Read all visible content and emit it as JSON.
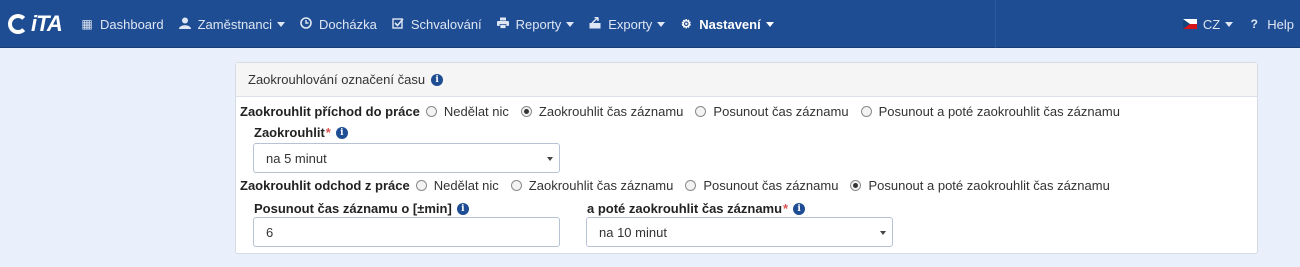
{
  "brand": {
    "logo_text": "iTA"
  },
  "nav": {
    "items": [
      {
        "label": "Dashboard",
        "icon": "grid-icon",
        "caret": false,
        "active": false
      },
      {
        "label": "Zaměstnanci",
        "icon": "user-icon",
        "caret": true,
        "active": false
      },
      {
        "label": "Docházka",
        "icon": "clock-icon",
        "caret": false,
        "active": false
      },
      {
        "label": "Schvalování",
        "icon": "check-square-icon",
        "caret": false,
        "active": false
      },
      {
        "label": "Reporty",
        "icon": "print-icon",
        "caret": true,
        "active": false
      },
      {
        "label": "Exporty",
        "icon": "export-icon",
        "caret": true,
        "active": false
      },
      {
        "label": "Nastavení",
        "icon": "gear-icon",
        "caret": true,
        "active": true
      }
    ],
    "language": "CZ",
    "help": "Help"
  },
  "panel": {
    "title": "Zaokrouhlování označení času",
    "arrival": {
      "label": "Zaokrouhlit příchod do práce",
      "options": [
        "Nedělat nic",
        "Zaokrouhlit čas záznamu",
        "Posunout čas záznamu",
        "Posunout a poté zaokrouhlit čas záznamu"
      ],
      "selected_index": 1,
      "round_label": "Zaokrouhlit",
      "round_value": "na 5 minut"
    },
    "departure": {
      "label": "Zaokrouhlit odchod z práce",
      "options": [
        "Nedělat nic",
        "Zaokrouhlit čas záznamu",
        "Posunout čas záznamu",
        "Posunout a poté zaokrouhlit čas záznamu"
      ],
      "selected_index": 3,
      "shift_label": "Posunout čas záznamu o [±min]",
      "shift_value": "6",
      "round_label": "a poté zaokrouhlit čas záznamu",
      "round_value": "na 10 minut"
    }
  },
  "colors": {
    "navbar": "#1f4d93",
    "background": "#e9f0fb",
    "required": "#d9534f"
  }
}
